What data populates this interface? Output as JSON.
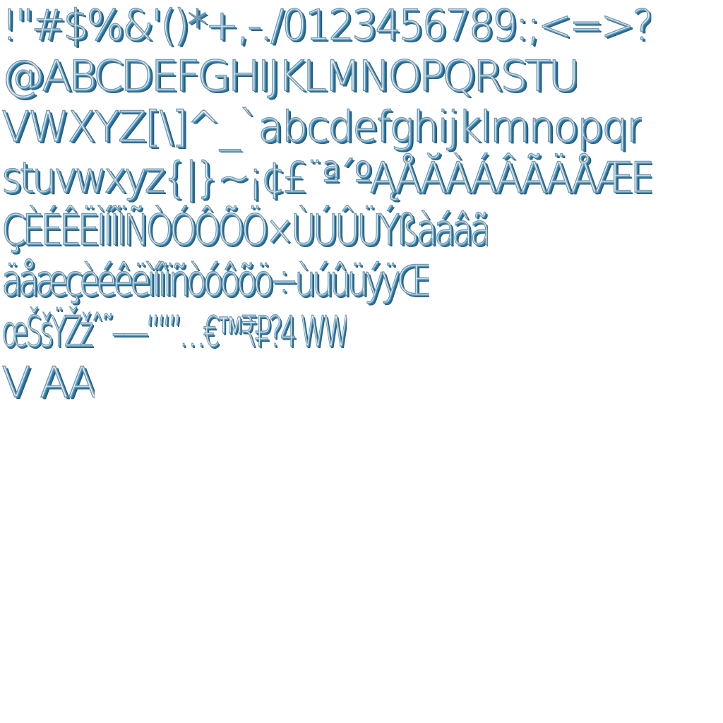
{
  "glyph_sheet": {
    "rows": [
      "!\"#$%&'()*+,-./0123456789:;<=>?",
      "@ABCDEFGHIJKLMNOPQRSTU",
      "VWXYZ[\\]^_`abcdefghijklmnopqr",
      "stuvwxyz{|}~¡¢£¨ª´ºĄÅĂÀÁÂÃÄÅÆE",
      "ÇÈÉÊËÌÍÎÏÑÒÓÔÕÖ×ÙÚÛÜÝßàáâã",
      "äåæçèéêëìíîïñòóôõö÷ùúûüýÿŒ",
      "œŠšŸŽžˆ˜–—‘’“”…€™₹₽?4 WW",
      "V AA"
    ]
  },
  "colors": {
    "glyph_fill": "#e2ebf0",
    "glyph_outline": "#7a98aa",
    "glyph_extrusion": "#1f78a8",
    "background": "#ffffff"
  }
}
